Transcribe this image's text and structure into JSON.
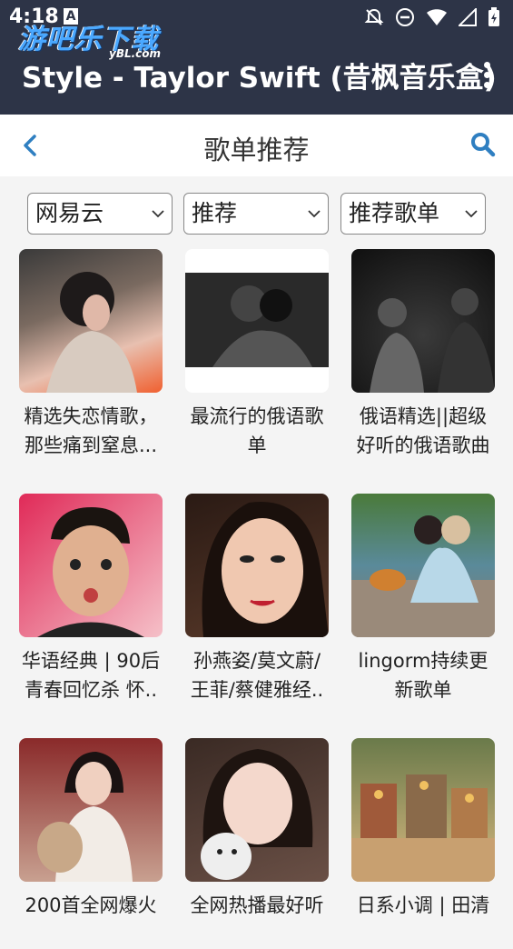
{
  "status_bar": {
    "time": "4:18",
    "a_label": "A"
  },
  "watermark": {
    "main": "游吧乐下载",
    "sub": "yBL.com"
  },
  "app_bar": {
    "title": "Style - Taylor Swift (昔枫音乐盒)"
  },
  "page": {
    "title": "歌单推荐"
  },
  "filters": [
    {
      "value": "网易云"
    },
    {
      "value": "推荐"
    },
    {
      "value": "推荐歌单"
    }
  ],
  "playlists": [
    {
      "line1": "精选失恋情歌，",
      "line2": "那些痛到窒息..."
    },
    {
      "line1": "最流行的俄语歌",
      "line2": "单"
    },
    {
      "line1": "俄语精选||超级",
      "line2": "好听的俄语歌曲"
    },
    {
      "line1": "华语经典 | 90后",
      "line2": "青春回忆杀 怀.."
    },
    {
      "line1": "孙燕姿/莫文蔚/",
      "line2": "王菲/蔡健雅经.."
    },
    {
      "line1": "lingorm持续更",
      "line2": "新歌单"
    },
    {
      "line1": "200首全网爆火",
      "line2": ""
    },
    {
      "line1": "全网热播最好听",
      "line2": ""
    },
    {
      "line1": "日系小调 | 田清",
      "line2": ""
    }
  ],
  "colors": {
    "header": "#2d3447",
    "accent": "#2f7fc1"
  }
}
